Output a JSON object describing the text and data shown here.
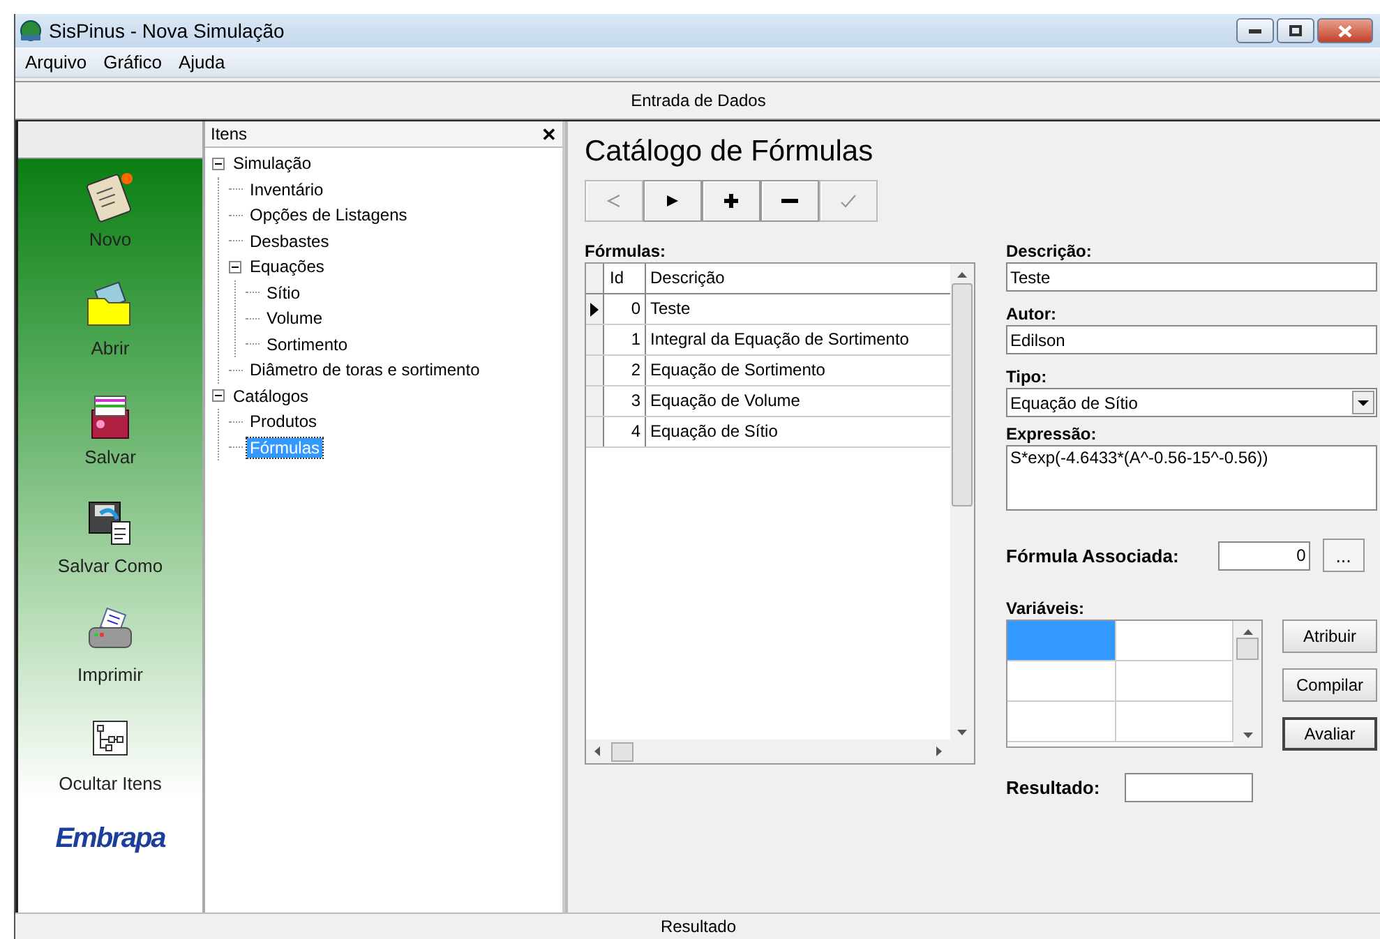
{
  "window": {
    "title": "SisPinus - Nova Simulação"
  },
  "menu": [
    "Arquivo",
    "Gráfico",
    "Ajuda"
  ],
  "header": "Entrada de Dados",
  "sidebar": {
    "items": [
      {
        "label": "Novo",
        "kind": "new"
      },
      {
        "label": "Abrir",
        "kind": "open"
      },
      {
        "label": "Salvar",
        "kind": "save"
      },
      {
        "label": "Salvar Como",
        "kind": "saveas"
      },
      {
        "label": "Imprimir",
        "kind": "print"
      },
      {
        "label": "Ocultar Itens",
        "kind": "hide"
      }
    ],
    "logo": "Embrapa"
  },
  "tree": {
    "title": "Itens",
    "close": "✕",
    "items": [
      {
        "label": "Simulação",
        "expanded": true,
        "selected": false,
        "children": [
          {
            "label": "Inventário",
            "selected": false
          },
          {
            "label": "Opções de Listagens",
            "selected": false
          },
          {
            "label": "Desbastes",
            "selected": false
          },
          {
            "label": "Equações",
            "expanded": true,
            "selected": false,
            "children": [
              {
                "label": "Sítio",
                "selected": false
              },
              {
                "label": "Volume",
                "selected": false
              },
              {
                "label": "Sortimento",
                "selected": false
              }
            ]
          },
          {
            "label": "Diâmetro de toras e sortimento",
            "selected": false
          }
        ]
      },
      {
        "label": "Catálogos",
        "expanded": true,
        "selected": false,
        "children": [
          {
            "label": "Produtos",
            "selected": false
          },
          {
            "label": "Fórmulas",
            "selected": true
          }
        ]
      }
    ]
  },
  "catalog": {
    "title": "Catálogo de Fórmulas",
    "nav": [
      {
        "kind": "prev",
        "disabled": true
      },
      {
        "kind": "next",
        "disabled": false
      },
      {
        "kind": "add",
        "disabled": false
      },
      {
        "kind": "remove",
        "disabled": false
      },
      {
        "kind": "confirm",
        "disabled": true
      }
    ],
    "table": {
      "label": "Fórmulas:",
      "columns": [
        "Id",
        "Descrição"
      ],
      "rows": [
        {
          "id": "0",
          "description": "Teste",
          "selected": true
        },
        {
          "id": "1",
          "description": "Integral da Equação de Sortimento",
          "selected": false
        },
        {
          "id": "2",
          "description": "Equação de Sortimento",
          "selected": false
        },
        {
          "id": "3",
          "description": "Equação de Volume",
          "selected": false
        },
        {
          "id": "4",
          "description": "Equação de Sítio",
          "selected": false
        }
      ]
    },
    "description": {
      "label": "Descrição:",
      "value": "Teste"
    },
    "author": {
      "label": "Autor:",
      "value": "Edilson"
    },
    "type": {
      "label": "Tipo:",
      "value": "Equação de Sítio"
    },
    "expression": {
      "label": "Expressão:",
      "value": "S*exp(-4.6433*(A^-0.56-15^-0.56))"
    },
    "associated": {
      "label": "Fórmula Associada:",
      "value": "0",
      "button": "..."
    },
    "variables": {
      "label": "Variáveis:",
      "rows": [
        {
          "cells": [
            {
              "selected": true
            },
            {
              "selected": false
            }
          ]
        },
        {
          "cells": [
            {
              "selected": false
            },
            {
              "selected": false
            }
          ]
        },
        {
          "cells": [
            {
              "selected": false
            },
            {
              "selected": false
            }
          ]
        }
      ]
    },
    "buttons": [
      {
        "label": "Atribuir",
        "focused": false
      },
      {
        "label": "Compilar",
        "focused": false
      },
      {
        "label": "Avaliar",
        "focused": true
      }
    ],
    "result": {
      "label": "Resultado:"
    }
  },
  "status_bar": "Resultado"
}
